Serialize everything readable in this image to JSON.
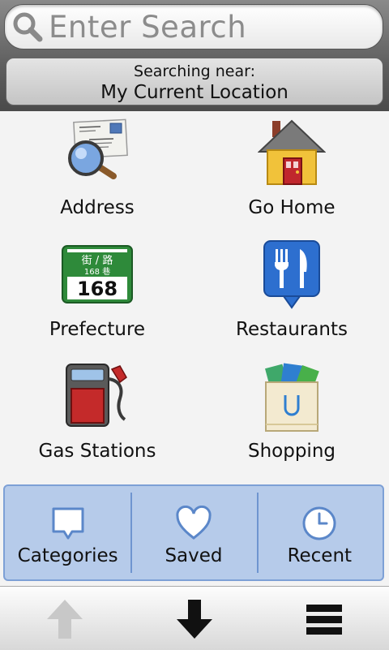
{
  "search": {
    "placeholder": "Enter Search"
  },
  "near": {
    "label": "Searching near:",
    "value": "My Current Location"
  },
  "categories": [
    {
      "label": "Address",
      "icon": "address-magnifier-icon"
    },
    {
      "label": "Go Home",
      "icon": "house-icon"
    },
    {
      "label": "Prefecture",
      "icon": "street-sign-icon",
      "sign_top": "街 / 路",
      "sign_mid": "168 巷",
      "sign_num": "168"
    },
    {
      "label": "Restaurants",
      "icon": "fork-knife-icon"
    },
    {
      "label": "Gas Stations",
      "icon": "fuel-pump-icon"
    },
    {
      "label": "Shopping",
      "icon": "shopping-bag-icon"
    }
  ],
  "tabs": [
    {
      "label": "Categories",
      "icon": "speech-bubble-icon"
    },
    {
      "label": "Saved",
      "icon": "heart-icon"
    },
    {
      "label": "Recent",
      "icon": "clock-icon"
    }
  ],
  "toolbar": {
    "up_icon": "arrow-up-icon",
    "down_icon": "arrow-down-icon",
    "menu_icon": "menu-icon"
  },
  "colors": {
    "tab_bar": "#b6cbea",
    "tab_border": "#7da0d6",
    "header": "#5e5e5e"
  }
}
